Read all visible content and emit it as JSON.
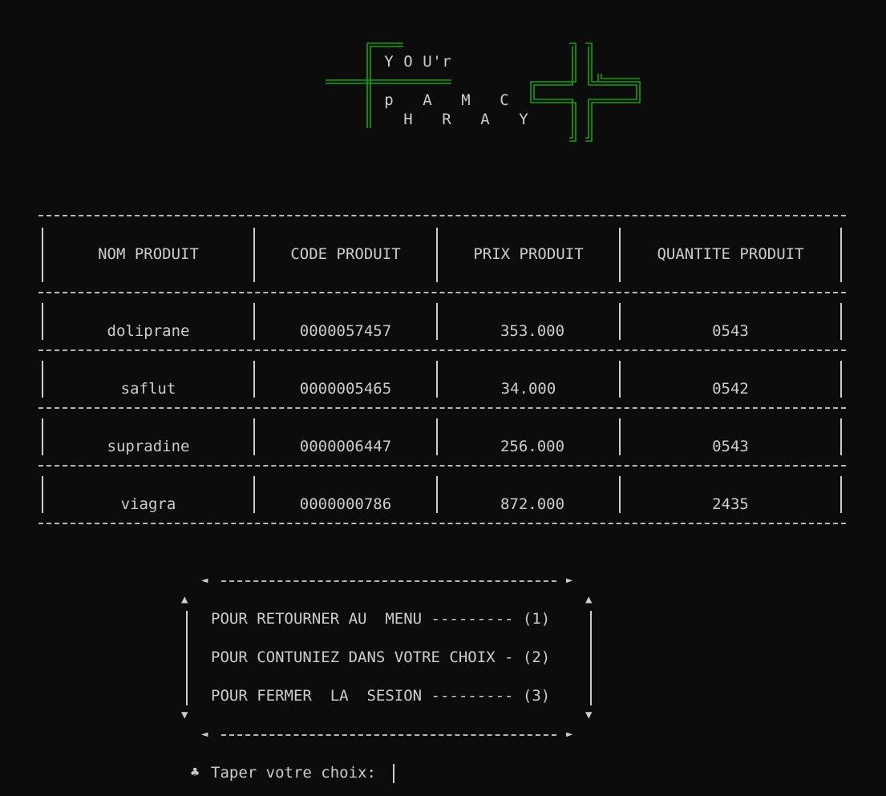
{
  "logo": {
    "line1": [
      "Y",
      "O",
      "U",
      "'",
      "r"
    ],
    "line2": [
      "p",
      "A",
      "M",
      "C"
    ],
    "line3": [
      "H",
      "R",
      "A",
      "Y"
    ]
  },
  "table": {
    "headers": [
      "NOM PRODUIT",
      "CODE PRODUIT",
      "PRIX PRODUIT",
      "QUANTITE PRODUIT"
    ],
    "rows": [
      [
        "doliprane",
        "0000057457",
        "353.000",
        "0543"
      ],
      [
        "saflut",
        "0000005465",
        "34.000",
        "0542"
      ],
      [
        "supradine",
        "0000006447",
        "256.000",
        "0543"
      ],
      [
        "viagra",
        "0000000786",
        "872.000",
        "2435"
      ]
    ]
  },
  "menu": {
    "options": [
      "POUR RETOURNER AU  MENU --------- (1)",
      "POUR CONTUNIEZ DANS VOTRE CHOIX - (2)",
      "POUR FERMER  LA  SESION --------- (3)"
    ]
  },
  "prompt": {
    "glyph": "♣",
    "text": "Taper votre choix:"
  },
  "colors": {
    "background": "#0c0c0c",
    "text": "#cccccc",
    "logo_green": "#13a10e"
  }
}
